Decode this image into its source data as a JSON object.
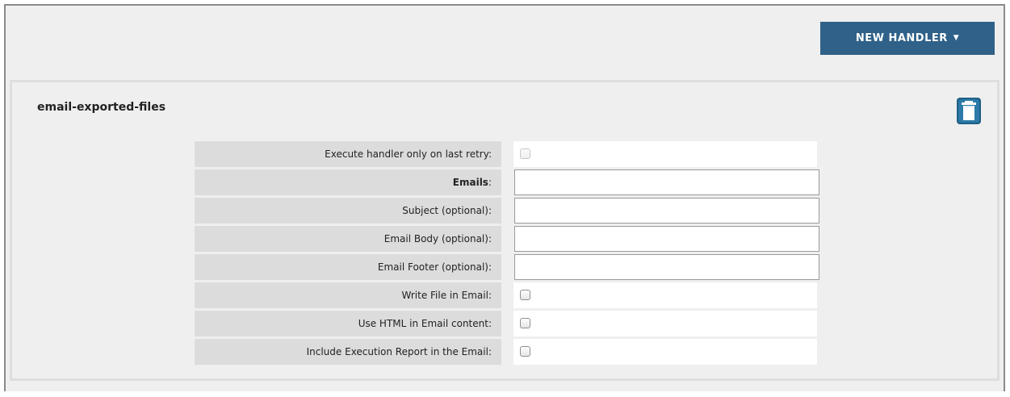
{
  "toolbar": {
    "new_handler_label": "NEW HANDLER",
    "new_handler_caret": "▼",
    "accent_color": "#2f6189"
  },
  "handler": {
    "name": "email-exported-files",
    "delete_icon": "trash-icon",
    "fields": {
      "last_retry": {
        "label": "Execute handler only on last retry:",
        "type": "checkbox",
        "checked": false,
        "disabled": true
      },
      "emails": {
        "label": "Emails",
        "label_suffix": ":",
        "type": "text",
        "value": "",
        "required": true
      },
      "subject": {
        "label": "Subject (optional):",
        "type": "text",
        "value": ""
      },
      "email_body": {
        "label": "Email Body (optional):",
        "type": "text",
        "value": ""
      },
      "email_footer": {
        "label": "Email Footer (optional):",
        "type": "text",
        "value": ""
      },
      "write_file": {
        "label": "Write File in Email:",
        "type": "checkbox",
        "checked": false
      },
      "use_html": {
        "label": "Use HTML in Email content:",
        "type": "checkbox",
        "checked": false
      },
      "include_report": {
        "label": "Include Execution Report in the Email:",
        "type": "checkbox",
        "checked": false
      }
    }
  }
}
